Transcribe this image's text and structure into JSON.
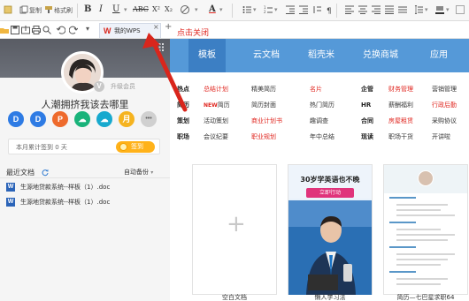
{
  "ribbon": {
    "paste_label": "粘贴",
    "copy_label": "复制",
    "format_painter_label": "格式刷",
    "bold": "B",
    "italic": "I",
    "underline": "U",
    "strikethrough": "ABC",
    "superscript": "X²",
    "subscript": "X₂",
    "font_color": "A"
  },
  "tab": {
    "logo": "W",
    "label": "我的WPS",
    "close": "×",
    "add": "+"
  },
  "annotation": "点击关闭",
  "profile": {
    "upgrade_label": "升级会员",
    "v_badge": "V",
    "motto": "人潮拥挤我该去哪里",
    "circles": [
      "D",
      "D",
      "P",
      "☁",
      "☁",
      "月",
      "•••"
    ],
    "circle_colors": [
      "#2e7be4",
      "#2e7be4",
      "#ee6a2c",
      "#19b37a",
      "#17a9ce",
      "#f5b31f",
      "#d0d0d0"
    ],
    "sign_text": "本月累计签到 0 天",
    "sign_button": "签到"
  },
  "recent": {
    "title": "最近文档",
    "backup_label": "自动备份",
    "files": [
      "生源地贷款系统--样板（1）.doc",
      "生源地贷款系统--样板（1）.doc"
    ]
  },
  "nav": {
    "tabs": [
      "模板",
      "云文档",
      "稻壳米",
      "兑换商城",
      "应用"
    ],
    "active": 0
  },
  "categories": {
    "rows": [
      [
        {
          "text": "热点",
          "style": "h"
        },
        {
          "text": "总结计划",
          "style": "r"
        },
        {
          "text": "精美简历",
          "style": "n"
        },
        {
          "text": "名片",
          "style": "r"
        },
        {
          "text": "企管",
          "style": "h"
        },
        {
          "text": "财务管理",
          "style": "r"
        },
        {
          "text": "营销管理",
          "style": "n"
        }
      ],
      [
        {
          "text": "简历",
          "style": "h"
        },
        {
          "text": "简历",
          "style": "n",
          "tag": "NEW"
        },
        {
          "text": "简历封面",
          "style": "n"
        },
        {
          "text": "热门简历",
          "style": "n"
        },
        {
          "text": "HR",
          "style": "h"
        },
        {
          "text": "薪酬福利",
          "style": "n"
        },
        {
          "text": "行政后勤",
          "style": "r"
        }
      ],
      [
        {
          "text": "策划",
          "style": "h"
        },
        {
          "text": "活动策划",
          "style": "n"
        },
        {
          "text": "商业计划书",
          "style": "r"
        },
        {
          "text": "趣调查",
          "style": "n"
        },
        {
          "text": "合同",
          "style": "h"
        },
        {
          "text": "房屋租赁",
          "style": "r"
        },
        {
          "text": "采购协议",
          "style": "n"
        }
      ],
      [
        {
          "text": "职场",
          "style": "h"
        },
        {
          "text": "会议纪要",
          "style": "n"
        },
        {
          "text": "职业规划",
          "style": "r"
        },
        {
          "text": "年中总结",
          "style": "n"
        },
        {
          "text": "现读",
          "style": "h"
        },
        {
          "text": "职场干货",
          "style": "n"
        },
        {
          "text": "开讲啦",
          "style": "n"
        }
      ]
    ]
  },
  "templates": [
    {
      "label": "空白文档",
      "plus": "+"
    },
    {
      "label": "懒人学习法",
      "headline": "30岁学英语也不晚",
      "button": "立即行动"
    },
    {
      "label": "简历—七巴星求职64"
    }
  ]
}
